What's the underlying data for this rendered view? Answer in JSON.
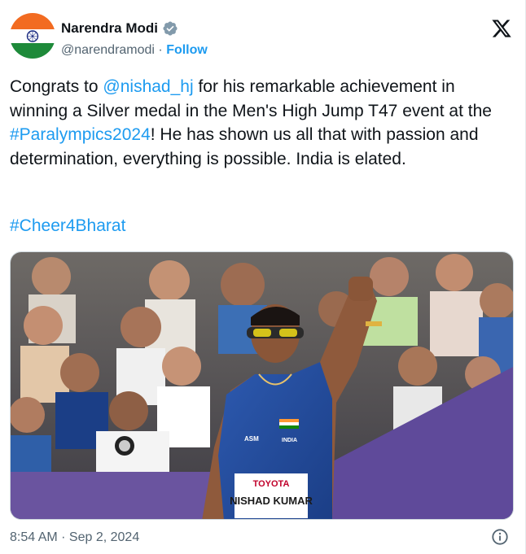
{
  "author": {
    "name": "Narendra Modi",
    "handle": "@narendramodi",
    "separator": " · ",
    "follow_label": "Follow"
  },
  "tweet": {
    "text_part1": "Congrats to ",
    "mention": "@nishad_hj",
    "text_part2": " for his remarkable achievement in winning a Silver medal in the Men's High Jump T47 event at the ",
    "hashtag1": "#Paralympics2024",
    "text_part3": "! He has shown us all that with passion and determination, everything is possible. India is elated.",
    "hashtag2": "#Cheer4Bharat"
  },
  "media": {
    "bib_sponsor": "TOYOTA",
    "bib_name": "NISHAD KUMAR",
    "vest_sponsor": "ASM",
    "vest_country": "INDIA"
  },
  "footer": {
    "timestamp": "8:54 AM · Sep 2, 2024"
  },
  "colors": {
    "link": "#1d9bf0",
    "text": "#0f1419",
    "muted": "#536471"
  },
  "icons": {
    "brand": "x-logo-icon",
    "verified": "verified-badge-icon",
    "info": "info-icon"
  }
}
